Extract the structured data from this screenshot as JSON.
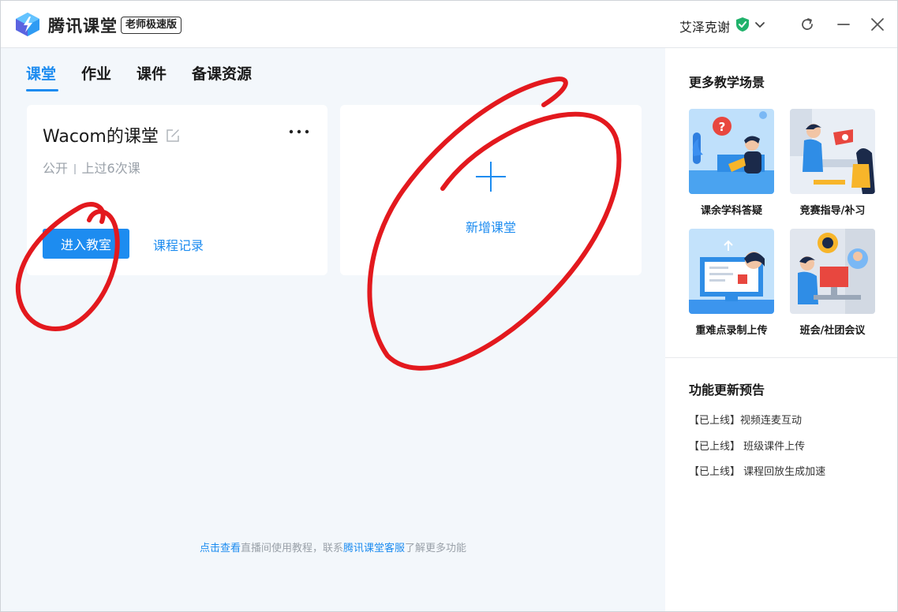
{
  "header": {
    "app_title": "腾讯课堂",
    "edition_badge": "老师极速版",
    "user_name": "艾泽克谢"
  },
  "tabs": [
    {
      "label": "课堂",
      "active": true
    },
    {
      "label": "作业",
      "active": false
    },
    {
      "label": "课件",
      "active": false
    },
    {
      "label": "备课资源",
      "active": false
    }
  ],
  "class_card": {
    "title": "Wacom的课堂",
    "visibility": "公开",
    "sessions": "上过6次课",
    "enter_button": "进入教室",
    "record_link": "课程记录"
  },
  "add_card": {
    "label": "新增课堂"
  },
  "footer": {
    "link1": "点击查看",
    "text1": "直播间使用教程，联系",
    "link2": "腾讯课堂客服",
    "text2": "了解更多功能"
  },
  "sidebar": {
    "scenes_title": "更多教学场景",
    "scenes": [
      {
        "label": "课余学科答疑"
      },
      {
        "label": "竞赛指导/补习"
      },
      {
        "label": "重难点录制上传"
      },
      {
        "label": "班会/社团会议"
      }
    ],
    "updates_title": "功能更新预告",
    "updates": [
      "【已上线】视频连麦互动",
      "【已上线】 班级课件上传",
      "【已上线】 课程回放生成加速"
    ]
  },
  "colors": {
    "accent": "#1d8cf0",
    "annotation": "#e3191e",
    "main_bg": "#f3f7fb"
  }
}
